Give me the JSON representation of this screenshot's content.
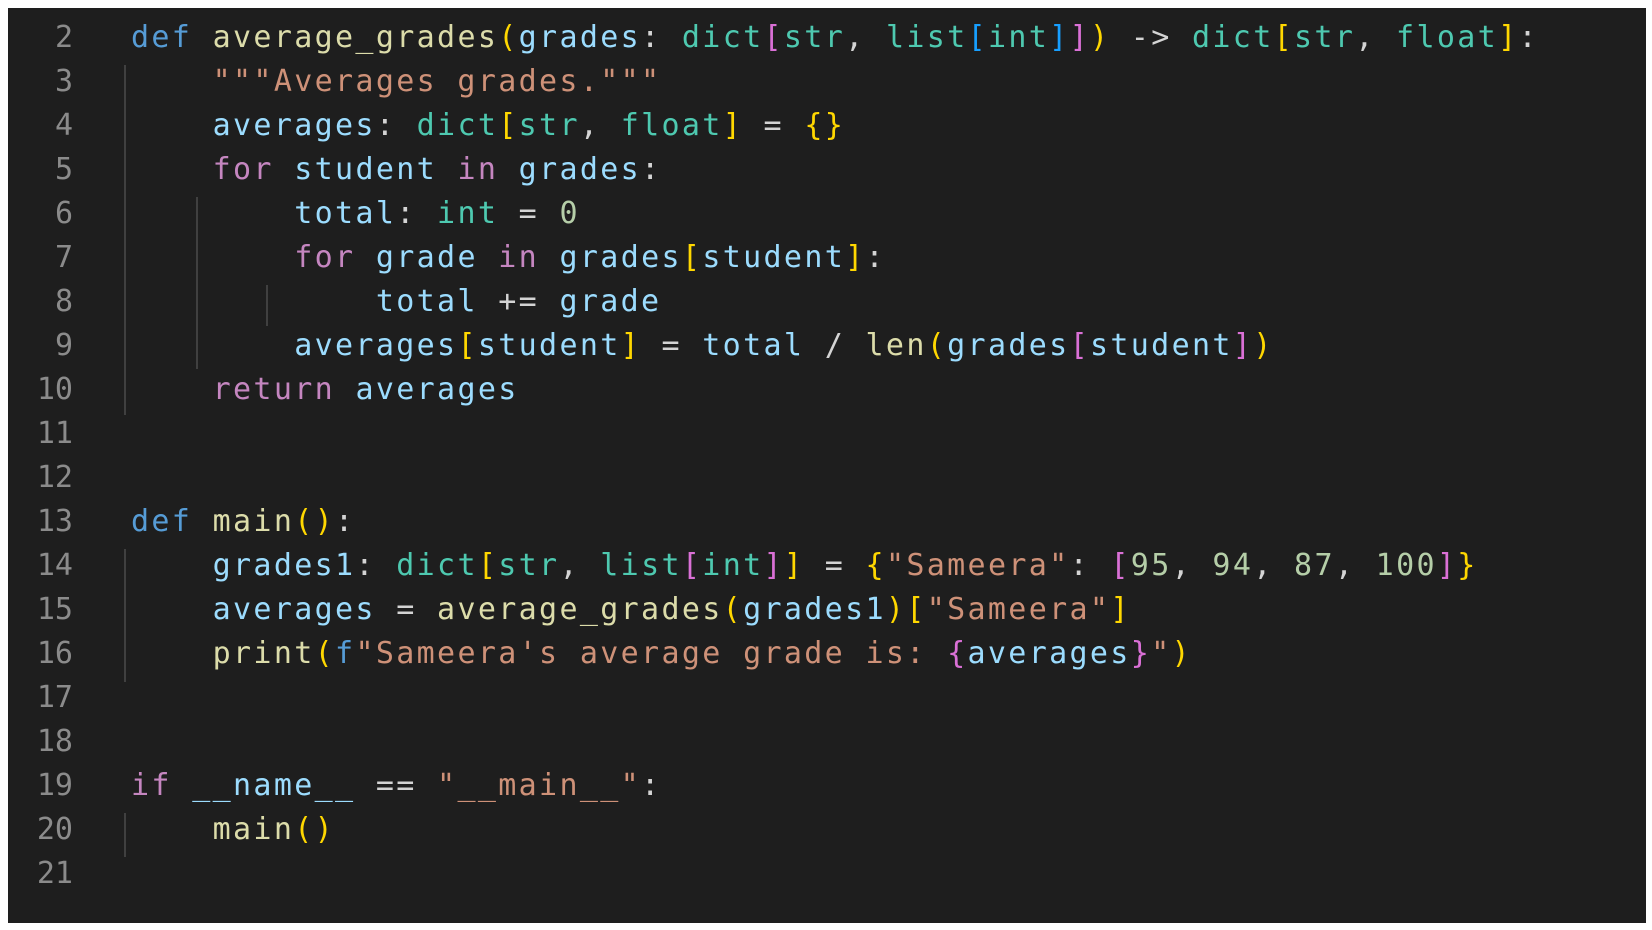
{
  "editor": {
    "language": "python",
    "theme_colors": {
      "background": "#1e1e1e",
      "line_number": "#8b8b8b",
      "keyword": "#569cd6",
      "control": "#c586c0",
      "function": "#dcdcaa",
      "variable": "#9cdcfe",
      "type": "#4ec9b0",
      "string": "#ce9178",
      "number": "#b5cea8",
      "operator": "#d4d4d4",
      "bracket_1": "#ffd700",
      "bracket_2": "#da70d6",
      "bracket_3": "#179fff"
    },
    "lines": [
      {
        "number": "2",
        "tokens": [
          {
            "text": "def",
            "kind": "keyword"
          },
          {
            "text": " ",
            "kind": "plain"
          },
          {
            "text": "average_grades",
            "kind": "function"
          },
          {
            "text": "(",
            "kind": "bracket_1"
          },
          {
            "text": "grades",
            "kind": "variable"
          },
          {
            "text": ": ",
            "kind": "plain"
          },
          {
            "text": "dict",
            "kind": "type"
          },
          {
            "text": "[",
            "kind": "bracket_2"
          },
          {
            "text": "str",
            "kind": "type"
          },
          {
            "text": ", ",
            "kind": "plain"
          },
          {
            "text": "list",
            "kind": "type"
          },
          {
            "text": "[",
            "kind": "bracket_3"
          },
          {
            "text": "int",
            "kind": "type"
          },
          {
            "text": "]",
            "kind": "bracket_3"
          },
          {
            "text": "]",
            "kind": "bracket_2"
          },
          {
            "text": ")",
            "kind": "bracket_1"
          },
          {
            "text": " -> ",
            "kind": "plain"
          },
          {
            "text": "dict",
            "kind": "type"
          },
          {
            "text": "[",
            "kind": "bracket_1"
          },
          {
            "text": "str",
            "kind": "type"
          },
          {
            "text": ", ",
            "kind": "plain"
          },
          {
            "text": "float",
            "kind": "type"
          },
          {
            "text": "]",
            "kind": "bracket_1"
          },
          {
            "text": ":",
            "kind": "plain"
          }
        ]
      },
      {
        "number": "3",
        "tokens": [
          {
            "text": "    ",
            "kind": "plain"
          },
          {
            "text": "\"\"\"Averages grades.\"\"\"",
            "kind": "string"
          }
        ]
      },
      {
        "number": "4",
        "tokens": [
          {
            "text": "    ",
            "kind": "plain"
          },
          {
            "text": "averages",
            "kind": "variable"
          },
          {
            "text": ": ",
            "kind": "plain"
          },
          {
            "text": "dict",
            "kind": "type"
          },
          {
            "text": "[",
            "kind": "bracket_1"
          },
          {
            "text": "str",
            "kind": "type"
          },
          {
            "text": ", ",
            "kind": "plain"
          },
          {
            "text": "float",
            "kind": "type"
          },
          {
            "text": "]",
            "kind": "bracket_1"
          },
          {
            "text": " = ",
            "kind": "plain"
          },
          {
            "text": "{}",
            "kind": "bracket_1"
          }
        ]
      },
      {
        "number": "5",
        "tokens": [
          {
            "text": "    ",
            "kind": "plain"
          },
          {
            "text": "for",
            "kind": "control"
          },
          {
            "text": " ",
            "kind": "plain"
          },
          {
            "text": "student",
            "kind": "variable"
          },
          {
            "text": " ",
            "kind": "plain"
          },
          {
            "text": "in",
            "kind": "control"
          },
          {
            "text": " ",
            "kind": "plain"
          },
          {
            "text": "grades",
            "kind": "variable"
          },
          {
            "text": ":",
            "kind": "plain"
          }
        ]
      },
      {
        "number": "6",
        "tokens": [
          {
            "text": "        ",
            "kind": "plain"
          },
          {
            "text": "total",
            "kind": "variable"
          },
          {
            "text": ": ",
            "kind": "plain"
          },
          {
            "text": "int",
            "kind": "type"
          },
          {
            "text": " = ",
            "kind": "plain"
          },
          {
            "text": "0",
            "kind": "number"
          }
        ]
      },
      {
        "number": "7",
        "tokens": [
          {
            "text": "        ",
            "kind": "plain"
          },
          {
            "text": "for",
            "kind": "control"
          },
          {
            "text": " ",
            "kind": "plain"
          },
          {
            "text": "grade",
            "kind": "variable"
          },
          {
            "text": " ",
            "kind": "plain"
          },
          {
            "text": "in",
            "kind": "control"
          },
          {
            "text": " ",
            "kind": "plain"
          },
          {
            "text": "grades",
            "kind": "variable"
          },
          {
            "text": "[",
            "kind": "bracket_1"
          },
          {
            "text": "student",
            "kind": "variable"
          },
          {
            "text": "]",
            "kind": "bracket_1"
          },
          {
            "text": ":",
            "kind": "plain"
          }
        ]
      },
      {
        "number": "8",
        "tokens": [
          {
            "text": "            ",
            "kind": "plain"
          },
          {
            "text": "total",
            "kind": "variable"
          },
          {
            "text": " += ",
            "kind": "plain"
          },
          {
            "text": "grade",
            "kind": "variable"
          }
        ]
      },
      {
        "number": "9",
        "tokens": [
          {
            "text": "        ",
            "kind": "plain"
          },
          {
            "text": "averages",
            "kind": "variable"
          },
          {
            "text": "[",
            "kind": "bracket_1"
          },
          {
            "text": "student",
            "kind": "variable"
          },
          {
            "text": "]",
            "kind": "bracket_1"
          },
          {
            "text": " = ",
            "kind": "plain"
          },
          {
            "text": "total",
            "kind": "variable"
          },
          {
            "text": " / ",
            "kind": "plain"
          },
          {
            "text": "len",
            "kind": "function"
          },
          {
            "text": "(",
            "kind": "bracket_1"
          },
          {
            "text": "grades",
            "kind": "variable"
          },
          {
            "text": "[",
            "kind": "bracket_2"
          },
          {
            "text": "student",
            "kind": "variable"
          },
          {
            "text": "]",
            "kind": "bracket_2"
          },
          {
            "text": ")",
            "kind": "bracket_1"
          }
        ]
      },
      {
        "number": "10",
        "tokens": [
          {
            "text": "    ",
            "kind": "plain"
          },
          {
            "text": "return",
            "kind": "control"
          },
          {
            "text": " ",
            "kind": "plain"
          },
          {
            "text": "averages",
            "kind": "variable"
          }
        ]
      },
      {
        "number": "11",
        "tokens": []
      },
      {
        "number": "12",
        "tokens": []
      },
      {
        "number": "13",
        "tokens": [
          {
            "text": "def",
            "kind": "keyword"
          },
          {
            "text": " ",
            "kind": "plain"
          },
          {
            "text": "main",
            "kind": "function"
          },
          {
            "text": "()",
            "kind": "bracket_1"
          },
          {
            "text": ":",
            "kind": "plain"
          }
        ]
      },
      {
        "number": "14",
        "tokens": [
          {
            "text": "    ",
            "kind": "plain"
          },
          {
            "text": "grades1",
            "kind": "variable"
          },
          {
            "text": ": ",
            "kind": "plain"
          },
          {
            "text": "dict",
            "kind": "type"
          },
          {
            "text": "[",
            "kind": "bracket_1"
          },
          {
            "text": "str",
            "kind": "type"
          },
          {
            "text": ", ",
            "kind": "plain"
          },
          {
            "text": "list",
            "kind": "type"
          },
          {
            "text": "[",
            "kind": "bracket_2"
          },
          {
            "text": "int",
            "kind": "type"
          },
          {
            "text": "]",
            "kind": "bracket_2"
          },
          {
            "text": "]",
            "kind": "bracket_1"
          },
          {
            "text": " = ",
            "kind": "plain"
          },
          {
            "text": "{",
            "kind": "bracket_1"
          },
          {
            "text": "\"Sameera\"",
            "kind": "string"
          },
          {
            "text": ": ",
            "kind": "plain"
          },
          {
            "text": "[",
            "kind": "bracket_2"
          },
          {
            "text": "95",
            "kind": "number"
          },
          {
            "text": ", ",
            "kind": "plain"
          },
          {
            "text": "94",
            "kind": "number"
          },
          {
            "text": ", ",
            "kind": "plain"
          },
          {
            "text": "87",
            "kind": "number"
          },
          {
            "text": ", ",
            "kind": "plain"
          },
          {
            "text": "100",
            "kind": "number"
          },
          {
            "text": "]",
            "kind": "bracket_2"
          },
          {
            "text": "}",
            "kind": "bracket_1"
          }
        ]
      },
      {
        "number": "15",
        "tokens": [
          {
            "text": "    ",
            "kind": "plain"
          },
          {
            "text": "averages",
            "kind": "variable"
          },
          {
            "text": " = ",
            "kind": "plain"
          },
          {
            "text": "average_grades",
            "kind": "function"
          },
          {
            "text": "(",
            "kind": "bracket_1"
          },
          {
            "text": "grades1",
            "kind": "variable"
          },
          {
            "text": ")",
            "kind": "bracket_1"
          },
          {
            "text": "[",
            "kind": "bracket_1"
          },
          {
            "text": "\"Sameera\"",
            "kind": "string"
          },
          {
            "text": "]",
            "kind": "bracket_1"
          }
        ]
      },
      {
        "number": "16",
        "tokens": [
          {
            "text": "    ",
            "kind": "plain"
          },
          {
            "text": "print",
            "kind": "function"
          },
          {
            "text": "(",
            "kind": "bracket_1"
          },
          {
            "text": "f",
            "kind": "keyword"
          },
          {
            "text": "\"Sameera's average grade is: ",
            "kind": "string"
          },
          {
            "text": "{",
            "kind": "bracket_2"
          },
          {
            "text": "averages",
            "kind": "variable"
          },
          {
            "text": "}",
            "kind": "bracket_2"
          },
          {
            "text": "\"",
            "kind": "string"
          },
          {
            "text": ")",
            "kind": "bracket_1"
          }
        ]
      },
      {
        "number": "17",
        "tokens": []
      },
      {
        "number": "18",
        "tokens": []
      },
      {
        "number": "19",
        "tokens": [
          {
            "text": "if",
            "kind": "control"
          },
          {
            "text": " ",
            "kind": "plain"
          },
          {
            "text": "__name__",
            "kind": "variable"
          },
          {
            "text": " == ",
            "kind": "plain"
          },
          {
            "text": "\"__main__\"",
            "kind": "string"
          },
          {
            "text": ":",
            "kind": "plain"
          }
        ]
      },
      {
        "number": "20",
        "tokens": [
          {
            "text": "    ",
            "kind": "plain"
          },
          {
            "text": "main",
            "kind": "function"
          },
          {
            "text": "()",
            "kind": "bracket_1"
          }
        ]
      },
      {
        "number": "21",
        "tokens": []
      }
    ]
  }
}
